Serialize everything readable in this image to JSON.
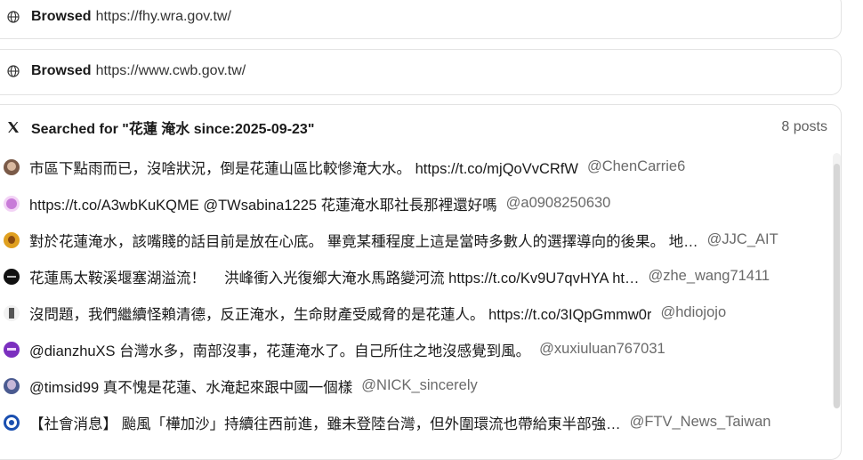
{
  "browse": [
    {
      "verb": "Browsed",
      "url": "https://fhy.wra.gov.tw/"
    },
    {
      "verb": "Browsed",
      "url": "https://www.cwb.gov.tw/"
    }
  ],
  "search": {
    "title": "Searched for \"花蓮 淹水 since:2025-09-23\"",
    "count": "8 posts"
  },
  "posts": [
    {
      "text": "市區下點雨而已，沒啥狀況，倒是花蓮山區比較慘淹大水。 https://t.co/mjQoVvCRfW",
      "handle": "@ChenCarrie6",
      "avatar_color": "#7a5a48"
    },
    {
      "text": "https://t.co/A3wbKuKQME @TWsabina1225 花蓮淹水耶社長那裡還好嗎",
      "handle": "@a0908250630",
      "avatar_color": "#c87bd8"
    },
    {
      "text": "對於花蓮淹水，該嘴賤的話目前是放在心底。 畢竟某種程度上這是當時多數人的選擇導向的後果。 地…",
      "handle": "@JJC_AIT",
      "avatar_color": "#e0a020"
    },
    {
      "text": "花蓮馬太鞍溪堰塞湖溢流！　 洪峰衝入光復鄉大淹水馬路變河流 https://t.co/Kv9U7qvHYA ht…",
      "handle": "@zhe_wang71411",
      "avatar_color": "#111111"
    },
    {
      "text": "沒問題，我們繼續怪賴清德，反正淹水，生命財產受威脅的是花蓮人。 https://t.co/3IQpGmmw0r",
      "handle": "@hdiojojo",
      "avatar_color": "#e6e6e6"
    },
    {
      "text": "@dianzhuXS 台灣水多，南部沒事，花蓮淹水了。自己所住之地沒感覺到風。",
      "handle": "@xuxiuluan767031",
      "avatar_color": "#7b2fbf"
    },
    {
      "text": "@timsid99 真不愧是花蓮、水淹起來跟中國一個樣",
      "handle": "@NICK_sincerely",
      "avatar_color": "#4a5a90"
    },
    {
      "text": "【社會消息】 颱風「樺加沙」持續往西前進，雖未登陸台灣，但外圍環流也帶給東半部強…",
      "handle": "@FTV_News_Taiwan",
      "avatar_color": "#1a4fb0"
    }
  ],
  "icons": {
    "browse": "globe-icon",
    "search": "x-logo-icon"
  }
}
